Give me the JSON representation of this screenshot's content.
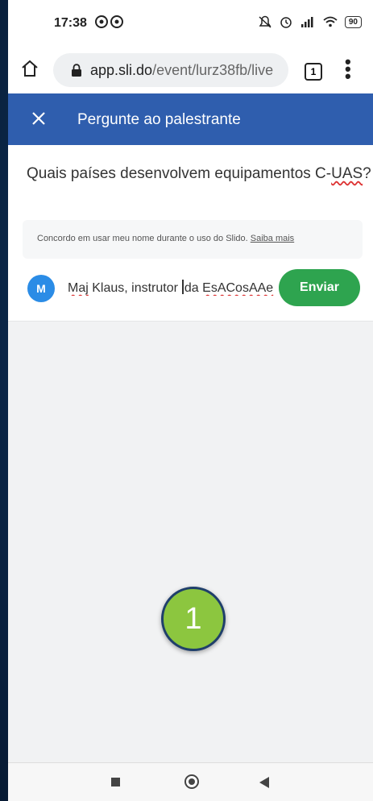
{
  "status": {
    "time": "17:38",
    "app_icons": "⓪⓪",
    "battery": "90"
  },
  "browser": {
    "url_domain": "app.sli.do",
    "url_path": "/event/lurz38fb/live",
    "tab_count": "1"
  },
  "header": {
    "title": "Pergunte ao palestrante"
  },
  "question": {
    "text_prefix": "Quais países desenvolvem equipamentos C-",
    "text_flagged": "UAS",
    "text_suffix": "?"
  },
  "consent": {
    "text": "Concordo em usar meu nome durante o uso do Slido. ",
    "link": "Saiba mais"
  },
  "author": {
    "avatar_initial": "M",
    "name_flagged": "Maj",
    "name_mid_before_cursor": " Klaus, instrutor ",
    "name_mid_after_cursor": "da ",
    "name_flagged_2": "EsACosAAe"
  },
  "actions": {
    "send_label": "Enviar"
  },
  "overlay": {
    "step_number": "1"
  },
  "colors": {
    "header_bg": "#2f5eae",
    "send_bg": "#2ea44f",
    "avatar_bg": "#2b8ce6",
    "badge_bg": "#8cc63f"
  }
}
